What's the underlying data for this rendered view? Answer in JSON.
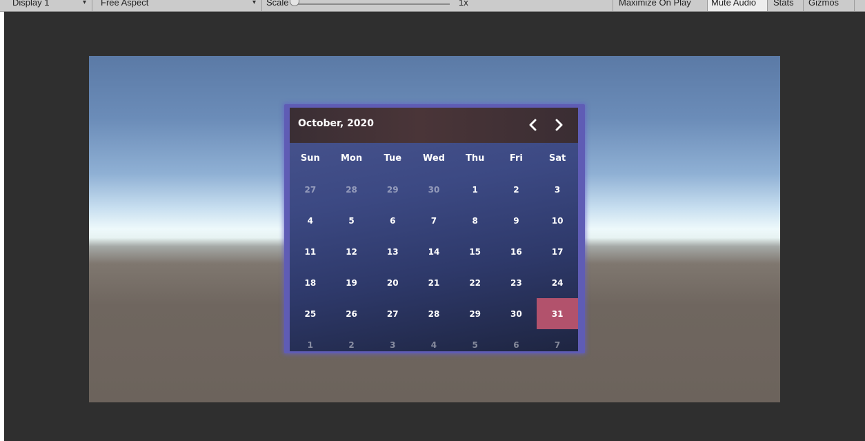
{
  "toolbar": {
    "display": "Display 1",
    "aspect": "Free Aspect",
    "scale_label": "Scale",
    "scale_value": "1x",
    "maximize": "Maximize On Play",
    "mute": "Mute Audio",
    "stats": "Stats",
    "gizmos": "Gizmos",
    "dropdown_arrow": "▾",
    "scale_slider_fraction": 0.0,
    "mute_enabled": true
  },
  "calendar": {
    "title": "October, 2020",
    "prev_icon": "chevron-left-icon",
    "next_icon": "chevron-right-icon",
    "weekdays": [
      "Sun",
      "Mon",
      "Tue",
      "Wed",
      "Thu",
      "Fri",
      "Sat"
    ],
    "weeks": [
      [
        {
          "d": "27",
          "m": true
        },
        {
          "d": "28",
          "m": true
        },
        {
          "d": "29",
          "m": true
        },
        {
          "d": "30",
          "m": true
        },
        {
          "d": "1"
        },
        {
          "d": "2"
        },
        {
          "d": "3"
        }
      ],
      [
        {
          "d": "4"
        },
        {
          "d": "5"
        },
        {
          "d": "6"
        },
        {
          "d": "7"
        },
        {
          "d": "8"
        },
        {
          "d": "9"
        },
        {
          "d": "10"
        }
      ],
      [
        {
          "d": "11"
        },
        {
          "d": "12"
        },
        {
          "d": "13"
        },
        {
          "d": "14"
        },
        {
          "d": "15"
        },
        {
          "d": "16"
        },
        {
          "d": "17"
        }
      ],
      [
        {
          "d": "18"
        },
        {
          "d": "19"
        },
        {
          "d": "20"
        },
        {
          "d": "21"
        },
        {
          "d": "22"
        },
        {
          "d": "23"
        },
        {
          "d": "24"
        }
      ],
      [
        {
          "d": "25"
        },
        {
          "d": "26"
        },
        {
          "d": "27"
        },
        {
          "d": "28"
        },
        {
          "d": "29"
        },
        {
          "d": "30"
        },
        {
          "d": "31",
          "sel": true
        }
      ],
      [
        {
          "d": "1",
          "m": true
        },
        {
          "d": "2",
          "m": true
        },
        {
          "d": "3",
          "m": true
        },
        {
          "d": "4",
          "m": true
        },
        {
          "d": "5",
          "m": true
        },
        {
          "d": "6",
          "m": true
        },
        {
          "d": "7",
          "m": true
        }
      ]
    ],
    "colors": {
      "frame": "#5f5cb5",
      "selected": "#b2526c",
      "header": "#3f3035",
      "body_top": "#49558f",
      "body_bottom": "#1e2541"
    }
  }
}
